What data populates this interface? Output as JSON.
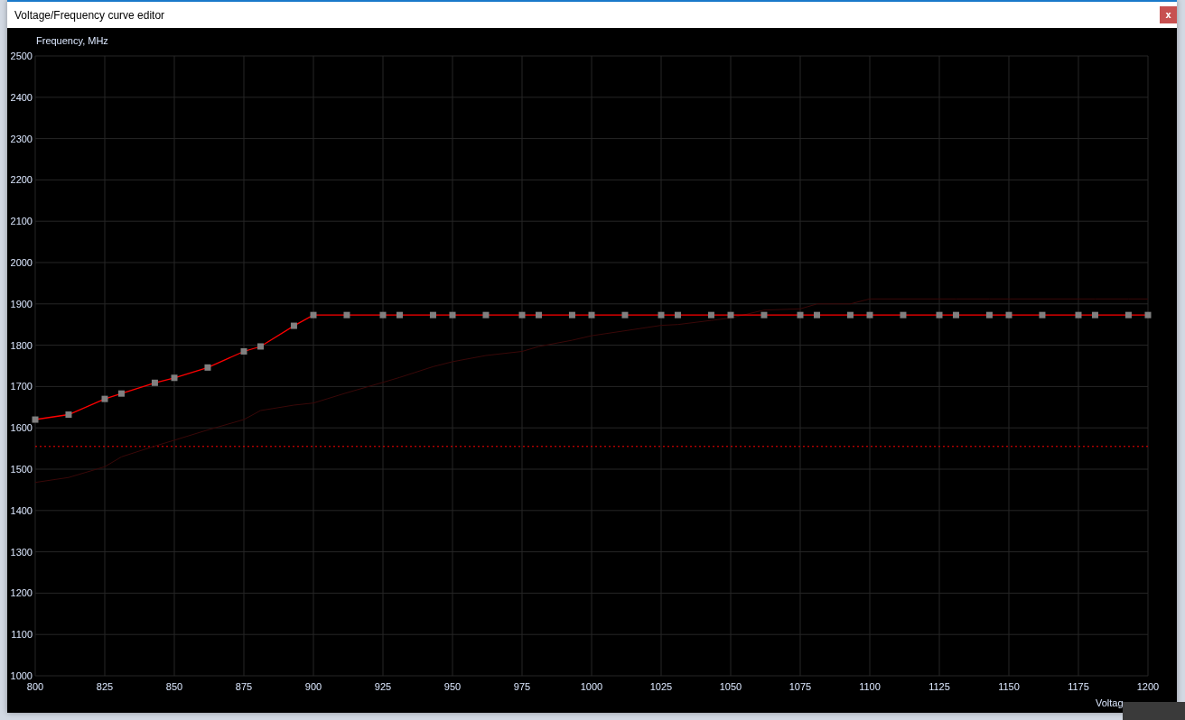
{
  "window": {
    "title": "Voltage/Frequency curve editor",
    "close_label": "x"
  },
  "chart_data": {
    "type": "line",
    "xlabel": "Voltag",
    "ylabel": "Frequency, MHz",
    "x": [
      800,
      812,
      825,
      831,
      843,
      850,
      862,
      875,
      881,
      893,
      900,
      912,
      925,
      931,
      943,
      950,
      962,
      975,
      981,
      993,
      1000,
      1012,
      1025,
      1031,
      1043,
      1050,
      1062,
      1075,
      1081,
      1093,
      1100,
      1112,
      1125,
      1131,
      1143,
      1150,
      1162,
      1175,
      1181,
      1193,
      1200
    ],
    "series": [
      {
        "color": "#ff0000",
        "marker": "square",
        "values": [
          1620,
          1632,
          1670,
          1683,
          1709,
          1721,
          1746,
          1785,
          1797,
          1847,
          1873,
          1873,
          1873,
          1873,
          1873,
          1873,
          1873,
          1873,
          1873,
          1873,
          1873,
          1873,
          1873,
          1873,
          1873,
          1873,
          1873,
          1873,
          1873,
          1873,
          1873,
          1873,
          1873,
          1873,
          1873,
          1873,
          1873,
          1873,
          1873,
          1873,
          1873
        ]
      },
      {
        "color": "#3a0808",
        "values": [
          1468,
          1480,
          1506,
          1530,
          1556,
          1570,
          1595,
          1620,
          1642,
          1655,
          1660,
          1685,
          1710,
          1722,
          1748,
          1760,
          1775,
          1785,
          1797,
          1812,
          1823,
          1835,
          1848,
          1850,
          1860,
          1866,
          1885,
          1888,
          1900,
          1900,
          1912,
          1912,
          1912,
          1912,
          1912,
          1912,
          1912,
          1912,
          1912,
          1912,
          1912
        ]
      }
    ],
    "xlim": [
      800,
      1200
    ],
    "ylim": [
      1000,
      2500
    ],
    "xticks": [
      800,
      825,
      850,
      875,
      900,
      925,
      950,
      975,
      1000,
      1025,
      1050,
      1075,
      1100,
      1125,
      1150,
      1175,
      1200
    ],
    "yticks": [
      1000,
      1100,
      1200,
      1300,
      1400,
      1500,
      1600,
      1700,
      1800,
      1900,
      2000,
      2100,
      2200,
      2300,
      2400,
      2500
    ],
    "grid": true,
    "ref_lines": [
      {
        "axis": "y",
        "value": 1555,
        "color": "#ff0000"
      }
    ]
  }
}
